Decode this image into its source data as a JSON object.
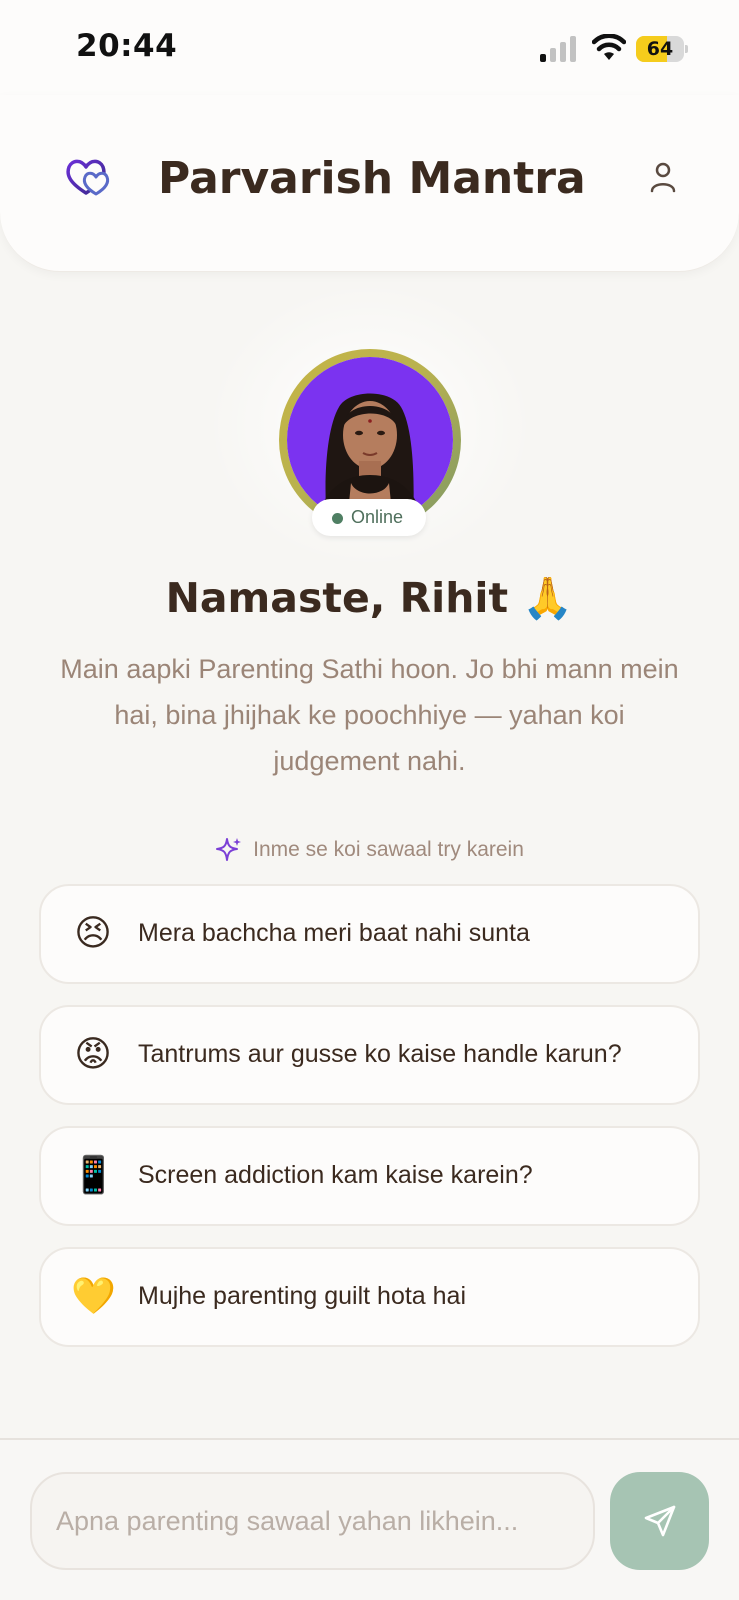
{
  "status_bar": {
    "time": "20:44",
    "battery_level": "64",
    "icons": [
      "signal-icon",
      "wifi-icon",
      "battery-icon"
    ]
  },
  "header": {
    "title": "Parvarish Mantra",
    "logo_icon": "hearts-logo-icon",
    "profile_icon": "person-icon"
  },
  "assistant": {
    "status": "Online",
    "greeting": "Namaste, Rihit 🙏",
    "intro": "Main aapki Parenting Sathi hoon. Jo bhi mann mein hai, bina jhijhak ke poochhiye — yahan koi judgement nahi."
  },
  "suggestions": {
    "label": "Inme se koi sawaal try karein",
    "icon": "sparkle-icon",
    "items": [
      {
        "emoji": "😣",
        "text": "Mera bachcha meri baat nahi sunta"
      },
      {
        "emoji": "😡",
        "text": "Tantrums aur gusse ko kaise handle karun?"
      },
      {
        "emoji": "📱",
        "text": "Screen addiction kam kaise karein?"
      },
      {
        "emoji": "💛",
        "text": "Mujhe parenting guilt hota hai"
      }
    ]
  },
  "composer": {
    "placeholder": "Apna parenting sawaal yahan likhein...",
    "value": "",
    "send_icon": "send-icon"
  },
  "colors": {
    "background": "#f7f6f3",
    "title_text": "#3b2a1f",
    "muted_text": "#9b8577",
    "brand_purple": "#5b2fc9",
    "online_green": "#4f7f63",
    "send_button": "#a6c4b3",
    "avatar_ring_gold": "#c6b545"
  }
}
